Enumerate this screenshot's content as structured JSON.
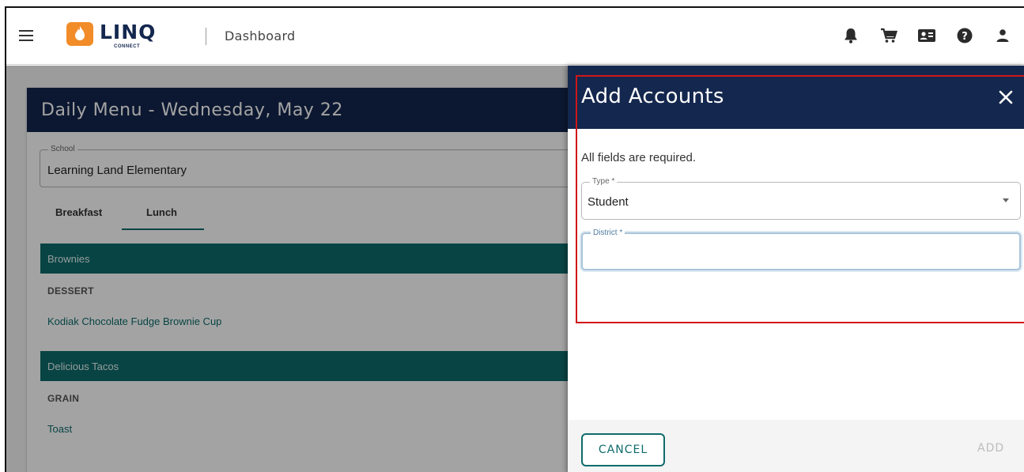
{
  "header": {
    "logo_text": "LINQ",
    "logo_subtext": "CONNECT",
    "breadcrumb": "Dashboard",
    "icons": [
      "notifications-icon",
      "cart-icon",
      "contact-card-icon",
      "help-icon",
      "account-icon"
    ]
  },
  "daily_menu": {
    "title": "Daily Menu - Wednesday, May 22",
    "school_label": "School",
    "school_value": "Learning Land Elementary",
    "tabs": [
      "Breakfast",
      "Lunch"
    ],
    "active_tab": "Lunch",
    "sections": [
      {
        "band": "Brownies",
        "category": "DESSERT",
        "item": "Kodiak Chocolate Fudge Brownie Cup"
      },
      {
        "band": "Delicious Tacos",
        "category": "GRAIN",
        "item": "Toast"
      }
    ]
  },
  "drawer": {
    "title": "Add Accounts",
    "required_note": "All fields are required.",
    "type_label": "Type *",
    "type_value": "Student",
    "district_label": "District *",
    "district_value": "",
    "cancel_label": "CANCEL",
    "add_label": "ADD"
  },
  "colors": {
    "navy": "#14274e",
    "teal": "#0f6b6b",
    "logo_orange": "#f28c28",
    "highlight_red": "#d01616"
  }
}
